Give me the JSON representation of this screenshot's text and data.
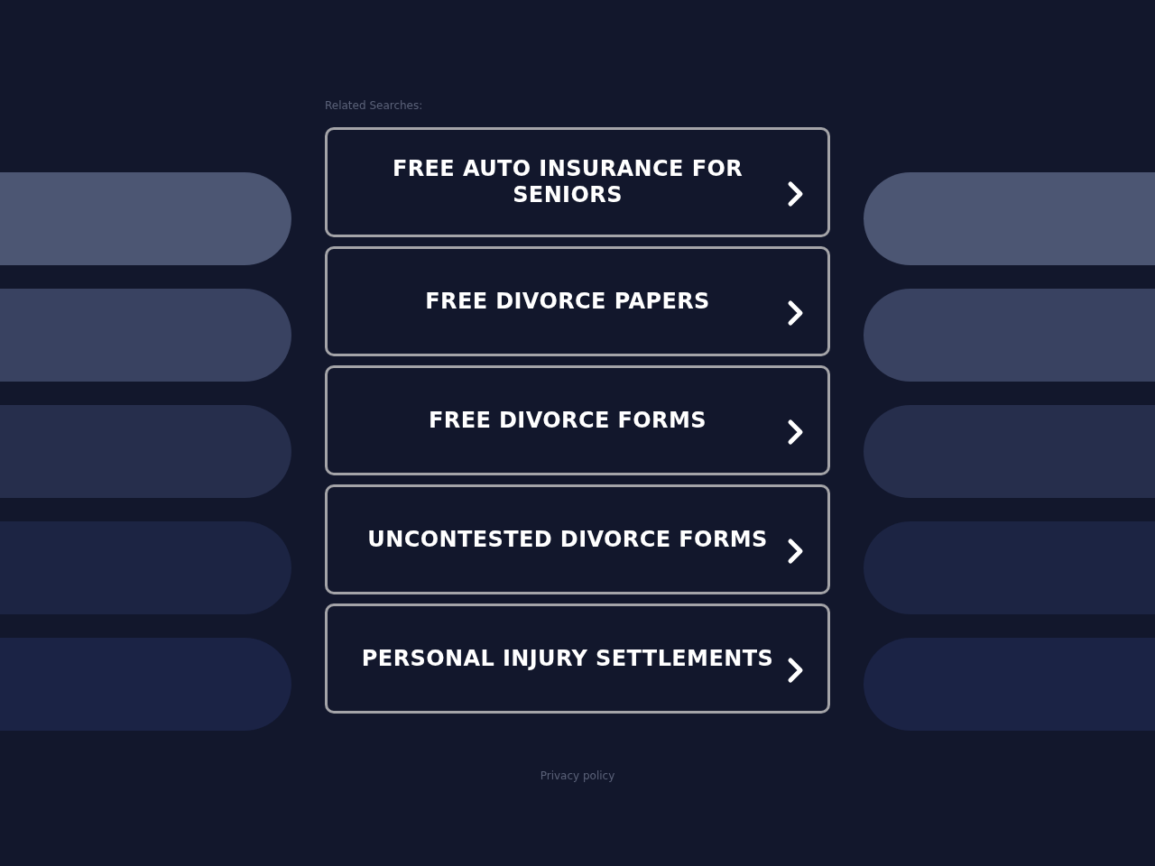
{
  "related_searches": {
    "label": "Related Searches:",
    "links": [
      {
        "text": "FREE AUTO INSURANCE FOR SENIORS"
      },
      {
        "text": "FREE DIVORCE PAPERS"
      },
      {
        "text": "FREE DIVORCE FORMS"
      },
      {
        "text": "UNCONTESTED DIVORCE FORMS"
      },
      {
        "text": "PERSONAL INJURY SETTLEMENTS"
      }
    ]
  },
  "footer": {
    "privacy_link": "Privacy policy"
  }
}
